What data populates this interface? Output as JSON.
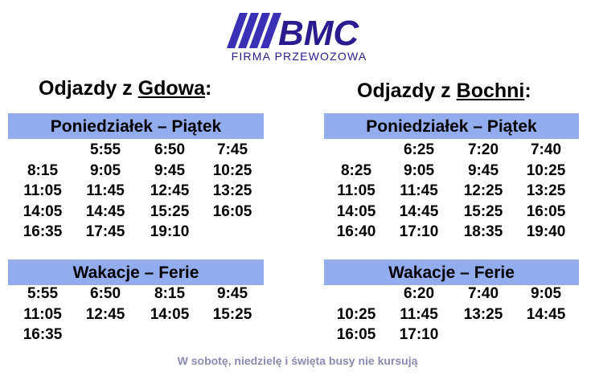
{
  "logo": {
    "brand": "BMC",
    "subtitle": "FIRMA PRZEWOZOWA",
    "brand_color": "#2a1b8f",
    "stripe_color": "#3b2fb5"
  },
  "left": {
    "heading_prefix": "Odjazdy z ",
    "heading_place": "Gdowa",
    "heading_suffix": ":",
    "weekday_label": "Poniedziałek – Piątek",
    "weekday_rows": [
      [
        "",
        "5:55",
        "6:50",
        "7:45"
      ],
      [
        "8:15",
        "9:05",
        "9:45",
        "10:25"
      ],
      [
        "11:05",
        "11:45",
        "12:45",
        "13:25"
      ],
      [
        "14:05",
        "14:45",
        "15:25",
        "16:05"
      ],
      [
        "16:35",
        "17:45",
        "19:10",
        ""
      ]
    ],
    "holiday_label": "Wakacje – Ferie",
    "holiday_rows": [
      [
        "5:55",
        "6:50",
        "8:15",
        "9:45"
      ],
      [
        "11:05",
        "12:45",
        "14:05",
        "15:25"
      ],
      [
        "16:35",
        "",
        "",
        ""
      ]
    ]
  },
  "right": {
    "heading_prefix": "Odjazdy z ",
    "heading_place": "Bochni",
    "heading_suffix": ":",
    "weekday_label": "Poniedziałek – Piątek",
    "weekday_rows": [
      [
        "",
        "6:25",
        "7:20",
        "7:40"
      ],
      [
        "8:25",
        "9:05",
        "9:45",
        "10:25"
      ],
      [
        "11:05",
        "11:45",
        "12:25",
        "13:25"
      ],
      [
        "14:05",
        "14:45",
        "15:25",
        "16:05"
      ],
      [
        "16:40",
        "17:10",
        "18:35",
        "19:40"
      ]
    ],
    "holiday_label": "Wakacje – Ferie",
    "holiday_rows": [
      [
        "",
        "6:20",
        "7:40",
        "9:05"
      ],
      [
        "10:25",
        "11:45",
        "13:25",
        "14:45"
      ],
      [
        "16:05",
        "17:10",
        "",
        ""
      ]
    ]
  },
  "footer": "W sobotę, niedzielę i święta busy nie kursują",
  "colors": {
    "band": "#93acee",
    "footer_text": "#8b8bb0"
  }
}
